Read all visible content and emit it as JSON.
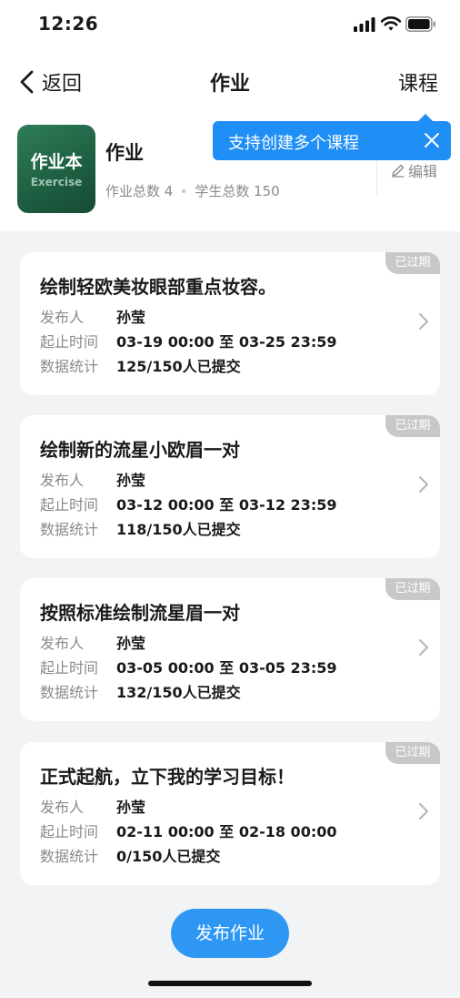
{
  "status_bar": {
    "time": "12:26"
  },
  "nav": {
    "back_label": "返回",
    "title": "作业",
    "right_link": "课程"
  },
  "tooltip": {
    "text": "支持创建多个课程"
  },
  "course": {
    "cover_title": "作业本",
    "cover_subtitle": "Exercise",
    "name": "作业",
    "homework_total": "作业总数 4",
    "student_total": "学生总数 150",
    "edit_label": "编辑"
  },
  "labels": {
    "publisher": "发布人",
    "period": "起止时间",
    "stats": "数据统计"
  },
  "assignments": [
    {
      "badge": "已过期",
      "title": "绘制轻欧美妆眼部重点妆容。",
      "publisher": "孙莹",
      "period": "03-19 00:00 至 03-25 23:59",
      "stats": "125/150人已提交"
    },
    {
      "badge": "已过期",
      "title": "绘制新的流星小欧眉一对",
      "publisher": "孙莹",
      "period": "03-12 00:00 至 03-12 23:59",
      "stats": "118/150人已提交"
    },
    {
      "badge": "已过期",
      "title": "按照标准绘制流星眉一对",
      "publisher": "孙莹",
      "period": "03-05 00:00 至 03-05 23:59",
      "stats": "132/150人已提交"
    },
    {
      "badge": "已过期",
      "title": "正式起航，立下我的学习目标！",
      "publisher": "孙莹",
      "period": "02-11 00:00 至 02-18 00:00",
      "stats": "0/150人已提交"
    }
  ],
  "publish_button": "发布作业",
  "colors": {
    "accent": "#1f8ef5",
    "button": "#2e97f3",
    "badge": "#c8c8c8",
    "cover": "#1d5e41"
  }
}
